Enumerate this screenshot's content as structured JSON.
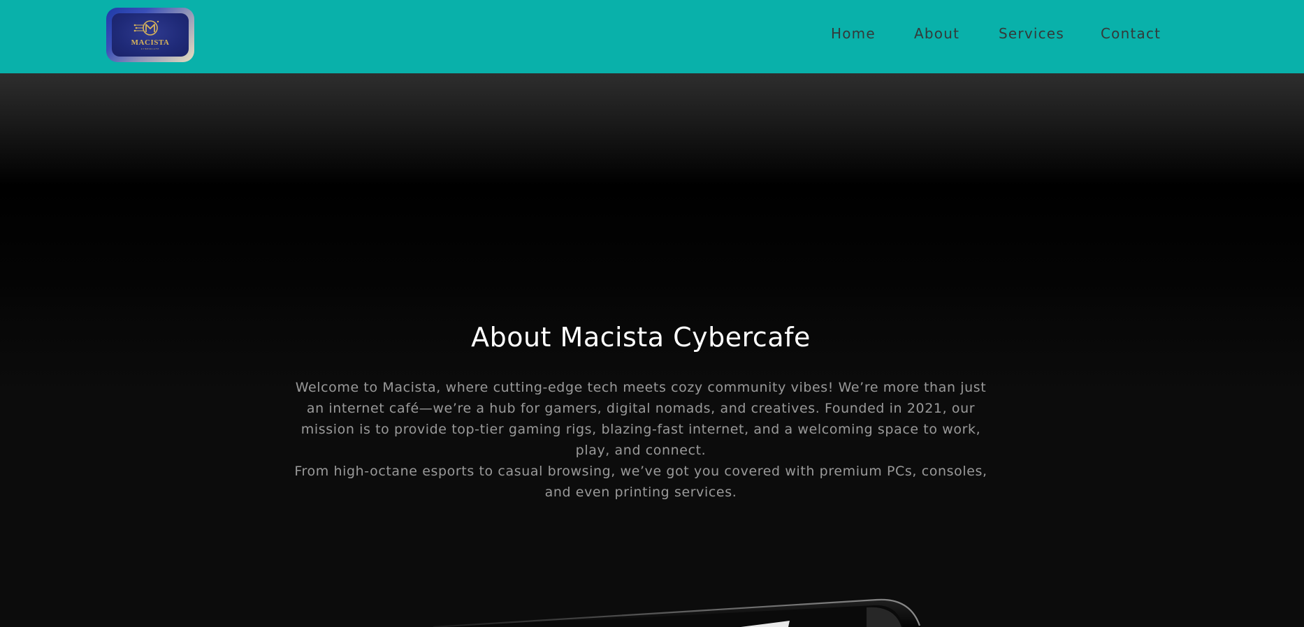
{
  "header": {
    "logo": {
      "text": "MACISTA",
      "subtext": "CYBERCAFE",
      "icon": "m-circuit-logo"
    },
    "nav": [
      {
        "label": "Home"
      },
      {
        "label": "About"
      },
      {
        "label": "Services"
      },
      {
        "label": "Contact"
      }
    ]
  },
  "about": {
    "title": "About Macista Cybercafe",
    "paragraph_1": "Welcome to Macista, where cutting-edge tech meets cozy community vibes! We’re more than just an internet café—we’re a hub for gamers, digital nomads, and creatives. Founded in 2021, our mission is to provide top-tier gaming rigs, blazing-fast internet, and a welcoming space to work, play, and connect.",
    "paragraph_2": "From high-octane esports to casual browsing, we’ve got you covered with premium PCs, consoles, and even printing services."
  },
  "colors": {
    "header_bg": "#09b1aa",
    "nav_text": "#333a3a",
    "page_bg": "#0c0c0c",
    "title_text": "#ffffff",
    "body_text": "#9a9a9a",
    "logo_gold": "#d8b45a"
  }
}
